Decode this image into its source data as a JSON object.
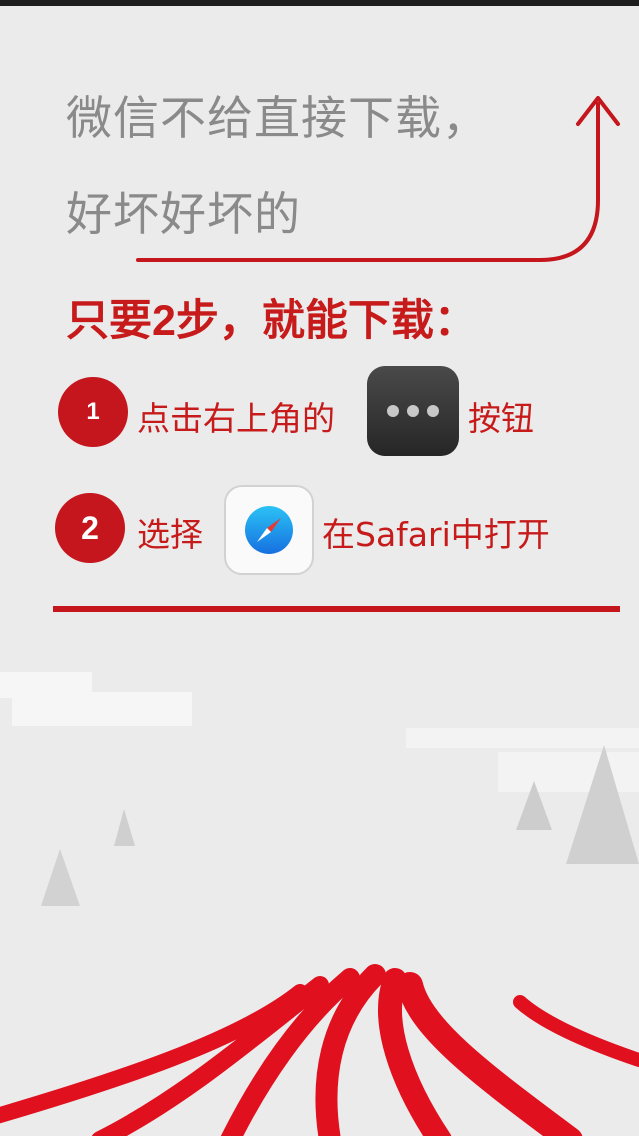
{
  "headline": {
    "line1": "微信不给直接下载，",
    "line2": "好坏好坏的"
  },
  "steps_title": "只要2步，就能下载：",
  "steps": [
    {
      "number": "1",
      "text_before": "点击右上角的",
      "icon": "more-menu-icon",
      "text_after": "按钮"
    },
    {
      "number": "2",
      "text_before": "选择",
      "icon": "safari-icon",
      "text_after": "在Safari中打开"
    }
  ],
  "colors": {
    "accent": "#c4161c",
    "background": "#ebebeb",
    "headline": "#8a8a8a"
  }
}
